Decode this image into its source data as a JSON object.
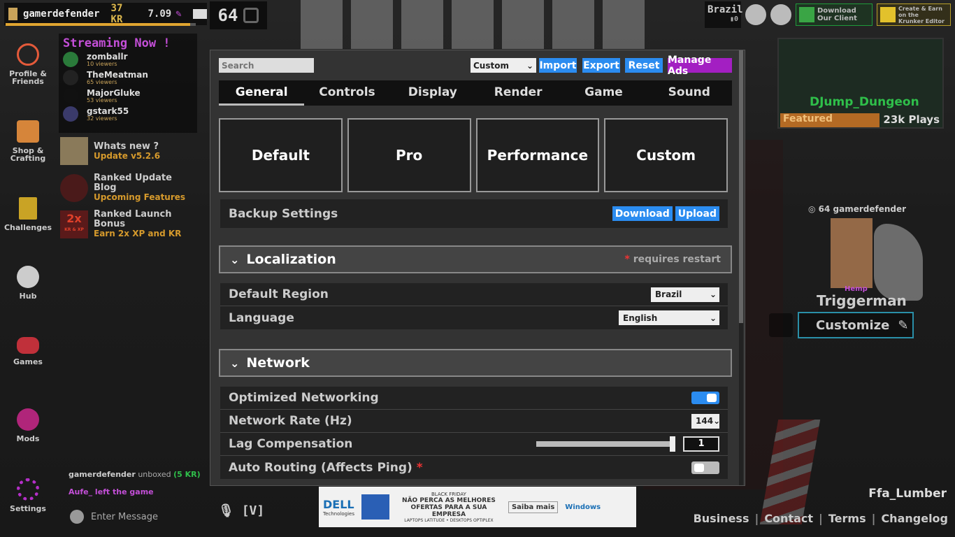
{
  "topbar": {
    "username": "gamerdefender",
    "kr": "37 KR",
    "level_value": "7.09",
    "xp_progress": 0.97,
    "player_level": "64",
    "region": "Brazil",
    "ping": "0"
  },
  "promos": {
    "client_line1": "Download",
    "client_line2": "Our Client",
    "editor_line1": "Create & Earn on the",
    "editor_line2": "Krunker Editor"
  },
  "nav": {
    "profile": "Profile & Friends",
    "shop": "Shop & Crafting",
    "challenges": "Challenges",
    "hub": "Hub",
    "games": "Games",
    "mods": "Mods",
    "settings": "Settings"
  },
  "streaming": {
    "title": "Streaming Now !",
    "streamers": [
      {
        "name": "zomballr",
        "viewers": "10 viewers"
      },
      {
        "name": "TheMeatman",
        "viewers": "65 viewers"
      },
      {
        "name": "MajorGluke",
        "viewers": "53 viewers"
      },
      {
        "name": "gstark55",
        "viewers": "32 viewers"
      }
    ]
  },
  "news": [
    {
      "title": "Whats new ?",
      "sub": "Update v5.2.6"
    },
    {
      "title": "Ranked Update Blog",
      "sub": "Upcoming Features"
    },
    {
      "title": "Ranked Launch Bonus",
      "sub": "Earn 2x XP and KR",
      "badge_big": "2x",
      "badge_small": "KR & XP"
    }
  ],
  "chat": {
    "line1_user": "gamerdefender",
    "line1_text": " unboxed ",
    "line1_item": "(5 KR)",
    "line2": "Aufe_ left the game",
    "placeholder": "Enter Message"
  },
  "voice": "[V]",
  "map": {
    "name": "DJump_Dungeon",
    "featured": "Featured",
    "plays": "23k Plays"
  },
  "character": {
    "level": "64",
    "name_small": "gamerdefender",
    "clan": "Hemp",
    "name": "Triggerman",
    "customize": "Customize"
  },
  "current_map": "Ffa_Lumber",
  "footer": [
    "Business",
    "Contact",
    "Terms",
    "Changelog"
  ],
  "ad": {
    "brand": "DELL",
    "brand_sub": "Technologies",
    "tag": "BLACK FRIDAY",
    "headline": "NÃO PERCA AS MELHORES OFERTAS PARA A SUA EMPRESA",
    "fine": "LAPTOPS LATITUDE • DESKTOPS OPTIPLEX",
    "cta": "Saiba mais",
    "windows": "Windows"
  },
  "settings": {
    "search_placeholder": "Search",
    "preset_selected": "Custom",
    "buttons": {
      "import": "Import",
      "export": "Export",
      "reset": "Reset",
      "manage_ads": "Manage Ads"
    },
    "tabs": [
      "General",
      "Controls",
      "Display",
      "Render",
      "Game",
      "Sound"
    ],
    "presets": [
      "Default",
      "Pro",
      "Performance",
      "Custom"
    ],
    "backup": {
      "label": "Backup Settings",
      "download": "Download",
      "upload": "Upload"
    },
    "localization": {
      "title": "Localization",
      "note_star": "*",
      "note": " requires restart",
      "default_region_label": "Default Region",
      "default_region_value": "Brazil",
      "language_label": "Language",
      "language_value": "English"
    },
    "network": {
      "title": "Network",
      "optimized_label": "Optimized Networking",
      "optimized_on": true,
      "rate_label": "Network Rate (Hz)",
      "rate_value": "144",
      "lag_label": "Lag Compensation",
      "lag_value": "1",
      "lag_slider_fraction": 1.0,
      "auto_label": "Auto Routing (Affects Ping)",
      "auto_star": "*",
      "auto_on": false
    }
  },
  "colors": {
    "accent_blue": "#2b8cf0",
    "accent_purple": "#a31fc2",
    "streaming": "#c44fd8",
    "kr": "#ddb84d"
  }
}
